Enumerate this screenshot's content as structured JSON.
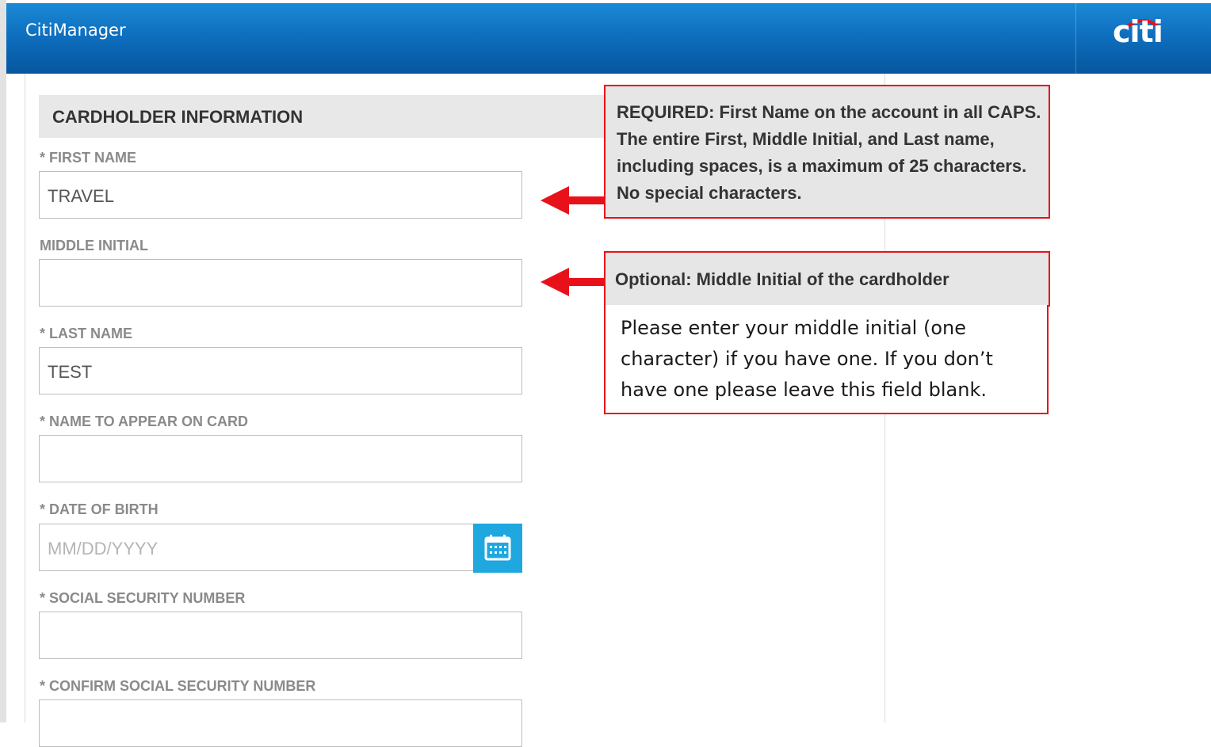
{
  "header": {
    "app_title": "CitiManager",
    "logo_text": "citi",
    "colors": {
      "bar_top": "#1a8ad6",
      "bar_bottom": "#06569e"
    }
  },
  "section": {
    "title": "CARDHOLDER INFORMATION"
  },
  "fields": [
    {
      "label": "* FIRST NAME",
      "value": "TRAVEL",
      "placeholder": ""
    },
    {
      "label": "MIDDLE INITIAL",
      "value": "",
      "placeholder": ""
    },
    {
      "label": "* LAST NAME",
      "value": "TEST",
      "placeholder": ""
    },
    {
      "label": "* NAME TO APPEAR ON CARD",
      "value": "",
      "placeholder": ""
    },
    {
      "label": "* DATE OF BIRTH",
      "value": "",
      "placeholder": "MM/DD/YYYY",
      "icon": "calendar-icon"
    },
    {
      "label": "* SOCIAL SECURITY NUMBER",
      "value": "",
      "placeholder": ""
    },
    {
      "label": "* CONFIRM SOCIAL SECURITY NUMBER",
      "value": "",
      "placeholder": ""
    }
  ],
  "callouts": {
    "first_name": "REQUIRED: First Name on the account in all CAPS. The entire First, Middle Initial, and Last name, including spaces, is a maximum of 25 characters. No special characters.",
    "middle_initial_title": "Optional: Middle Initial of the cardholder",
    "middle_initial_detail": "Please enter your middle initial (one character) if you have one. If you don’t have one please leave this field blank.",
    "colors": {
      "border": "#e8111a",
      "arrow": "#e8111a",
      "fill": "#e6e6e6"
    }
  }
}
